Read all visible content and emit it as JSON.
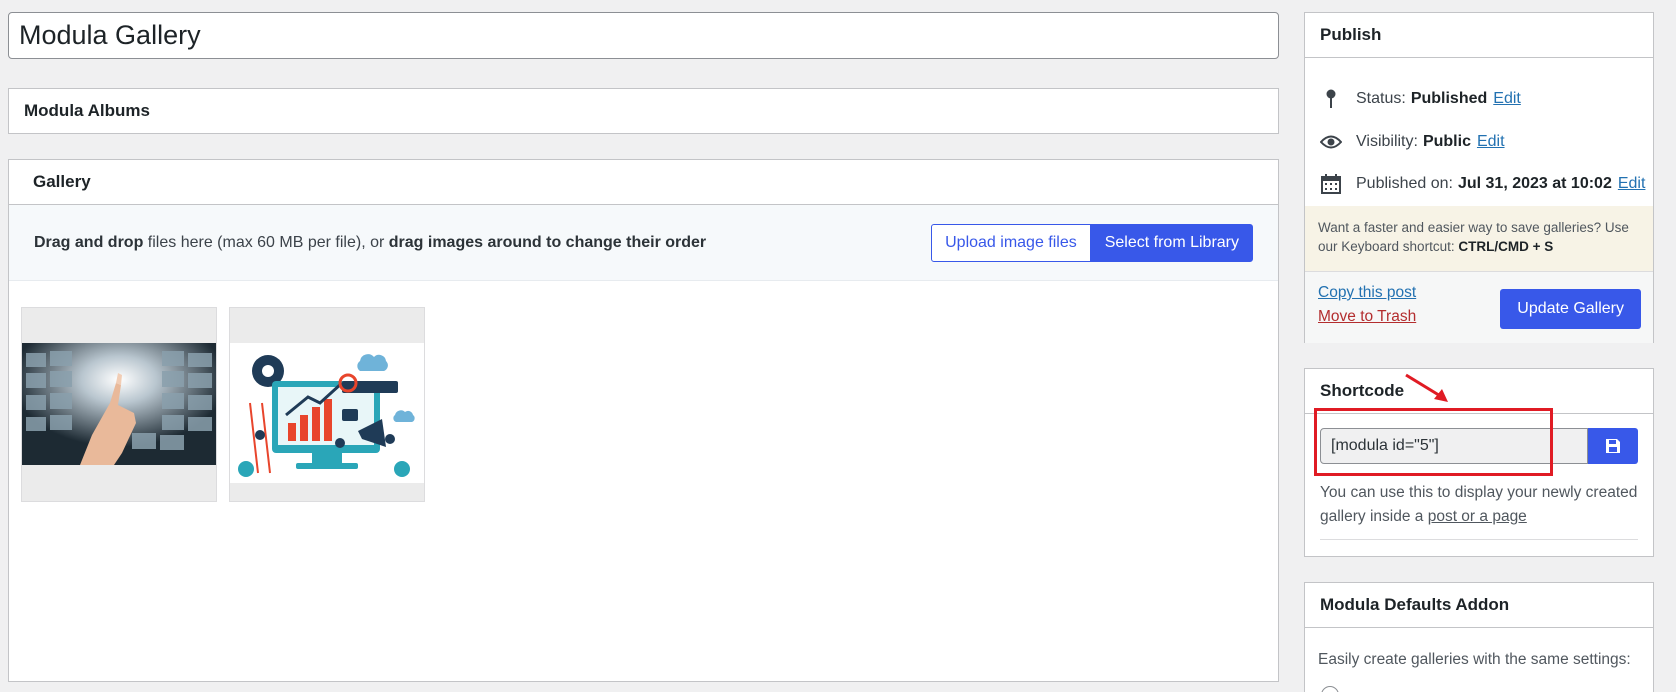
{
  "post_title": "Modula Gallery",
  "albums_box": {
    "title": "Modula Albums"
  },
  "gallery_box": {
    "title": "Gallery",
    "dropzone": {
      "strong1": "Drag and drop",
      "text1": " files here (max 60 MB per file), or ",
      "strong2": "drag images around to change their order"
    },
    "upload_label": "Upload image files",
    "library_label": "Select from Library",
    "images": [
      "gallery-image-1",
      "gallery-image-2"
    ]
  },
  "publish": {
    "title": "Publish",
    "status_label": "Status:",
    "status_value": "Published",
    "visibility_label": "Visibility:",
    "visibility_value": "Public",
    "published_label": "Published on:",
    "published_value": "Jul 31, 2023 at 10:02",
    "edit_label": "Edit",
    "notice_text": "Want a faster and easier way to save galleries? Use our Keyboard shortcut: ",
    "notice_shortcut": "CTRL/CMD + S",
    "copy_label": "Copy this post",
    "trash_label": "Move to Trash",
    "update_label": "Update Gallery"
  },
  "shortcode": {
    "title": "Shortcode",
    "value": "[modula id=\"5\"]",
    "desc": "You can use this to display your newly created gallery inside a ",
    "desc_link": "post or a page"
  },
  "defaults_addon": {
    "title": "Modula Defaults Addon",
    "text": "Easily create galleries with the same settings:"
  },
  "colors": {
    "accent": "#3858e9",
    "highlight": "#e01b24",
    "link": "#2271b1",
    "trash": "#b32d2e"
  },
  "icons": [
    "pin-icon",
    "eye-icon",
    "calendar-icon",
    "save-icon",
    "arrow-icon"
  ]
}
